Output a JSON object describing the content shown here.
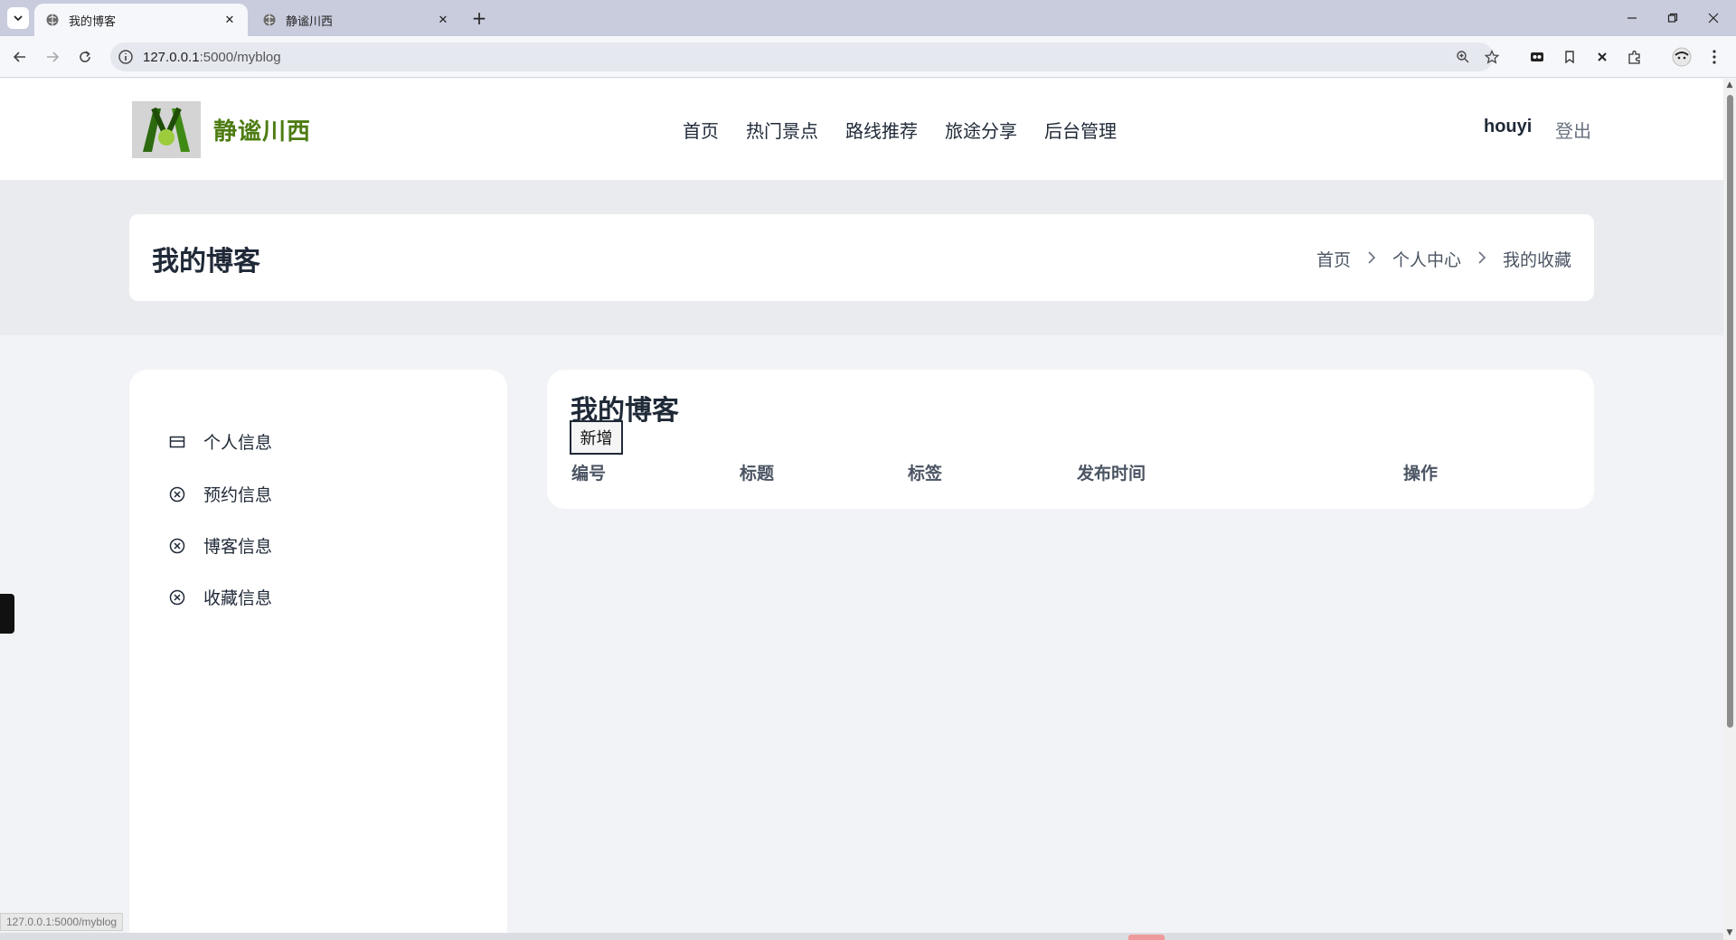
{
  "browser": {
    "tabs": [
      {
        "title": "我的博客",
        "active": true
      },
      {
        "title": "静谧川西",
        "active": false
      }
    ],
    "address": {
      "host": "127.0.0.1",
      "path": ":5000/myblog"
    },
    "status_url": "127.0.0.1:5000/myblog"
  },
  "header": {
    "brand": "静谧川西",
    "nav": [
      "首页",
      "热门景点",
      "路线推荐",
      "旅途分享",
      "后台管理"
    ],
    "username": "houyi",
    "logout": "登出"
  },
  "hero": {
    "title": "我的博客",
    "breadcrumb": [
      "首页",
      "个人中心",
      "我的收藏"
    ]
  },
  "sidebar": {
    "items": [
      {
        "label": "个人信息",
        "icon": "id-card-icon"
      },
      {
        "label": "预约信息",
        "icon": "circle-x-icon"
      },
      {
        "label": "博客信息",
        "icon": "circle-x-icon"
      },
      {
        "label": "收藏信息",
        "icon": "circle-x-icon"
      }
    ]
  },
  "content": {
    "title": "我的博客",
    "add_button": "新增",
    "columns": [
      "编号",
      "标题",
      "标签",
      "发布时间",
      "操作"
    ]
  },
  "colors": {
    "brand": "#4d7c12",
    "page_bg": "#f2f3f6",
    "hero_bg": "#e9ebef",
    "tabbar": "#c9ccdd"
  }
}
